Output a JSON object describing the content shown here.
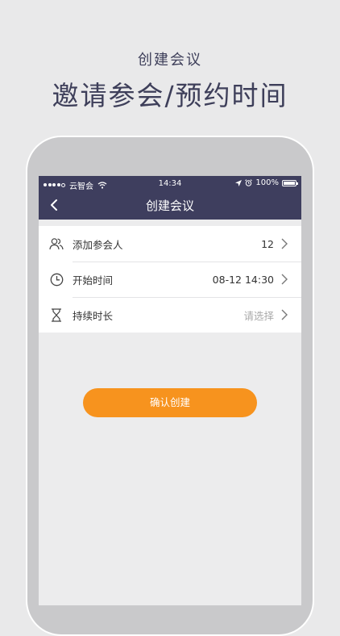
{
  "promo": {
    "subtitle": "创建会议",
    "title": "邀请参会/预约时间"
  },
  "status_bar": {
    "carrier": "云智会",
    "time": "14:34",
    "battery": "100%"
  },
  "nav": {
    "title": "创建会议",
    "back_icon": "chevron-left-icon"
  },
  "rows": [
    {
      "label": "添加参会人",
      "value": "12",
      "icon": "participants-icon"
    },
    {
      "label": "开始时间",
      "value": "08-12 14:30",
      "icon": "clock-icon"
    },
    {
      "label": "持续时长",
      "value": "请选择",
      "icon": "hourglass-icon",
      "is_placeholder": true
    }
  ],
  "confirm_button": {
    "label": "确认创建"
  },
  "colors": {
    "nav_bar": "#3e3e5e",
    "accent": "#f7931e",
    "background": "#e9e9ea",
    "headline": "#3e3f5a"
  }
}
